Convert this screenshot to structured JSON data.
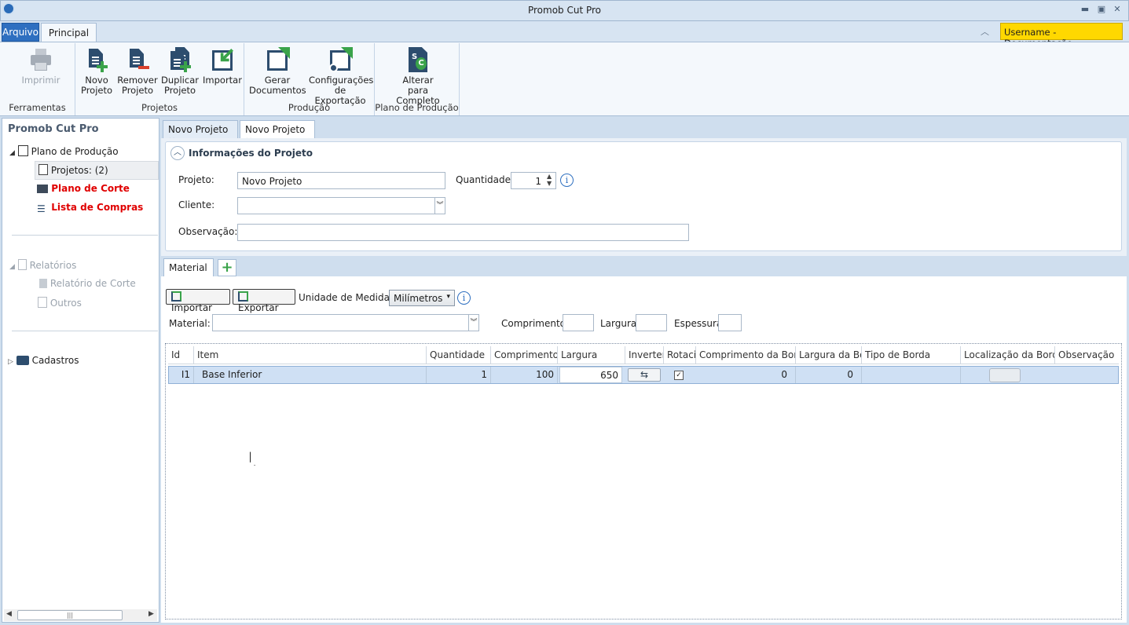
{
  "window": {
    "title": "Promob Cut Pro"
  },
  "ribbon": {
    "tabs": {
      "arquivo": "Arquivo",
      "principal": "Principal"
    },
    "user": "Username - Documentação",
    "groups": {
      "ferramentas": {
        "label": "Ferramentas",
        "imprimir": "Imprimir"
      },
      "projetos": {
        "label": "Projetos",
        "novo_1": "Novo",
        "novo_2": "Projeto",
        "remover_1": "Remover",
        "remover_2": "Projeto",
        "duplicar_1": "Duplicar",
        "duplicar_2": "Projeto",
        "importar": "Importar"
      },
      "producao": {
        "label": "Produção",
        "gerar_1": "Gerar",
        "gerar_2": "Documentos",
        "config_1": "Configurações",
        "config_2": "de Exportação"
      },
      "plano": {
        "label": "Plano de Produção",
        "alterar_1": "Alterar",
        "alterar_2": "para Completo"
      }
    }
  },
  "sidebar": {
    "title": "Promob Cut Pro",
    "plano_producao": "Plano de Produção",
    "projetos": "Projetos: (2)",
    "plano_corte": "Plano de Corte",
    "lista_compras": "Lista de Compras",
    "relatorios": "Relatórios",
    "relatorio_corte": "Relatório de Corte",
    "outros": "Outros",
    "cadastros": "Cadastros"
  },
  "doc_tabs": [
    "Novo Projeto",
    "Novo Projeto"
  ],
  "info": {
    "title": "Informações do Projeto",
    "projeto_label": "Projeto:",
    "projeto_value": "Novo Projeto",
    "quantidade_label": "Quantidade:",
    "quantidade_value": "1",
    "cliente_label": "Cliente:",
    "cliente_value": "",
    "observacao_label": "Observação:",
    "observacao_value": ""
  },
  "material_tab": "Material -",
  "toolbar": {
    "importar": "Importar",
    "exportar": "Exportar",
    "unidade_label": "Unidade de Medida :",
    "unidade_value": "Milímetros",
    "material_label": "Material:",
    "comprimento_label": "Comprimento:",
    "largura_label": "Largura:",
    "espessura_label": "Espessura:"
  },
  "table": {
    "columns": [
      "Id",
      "Item",
      "Quantidade",
      "Comprimento",
      "Largura",
      "Inverter",
      "Rotacionar",
      "Comprimento da Borda",
      "Largura da Borda",
      "Tipo de Borda",
      "Localização da Borda",
      "Observação"
    ],
    "rows": [
      {
        "id": "I1",
        "item": "Base Inferior",
        "quantidade": "1",
        "comprimento": "100",
        "largura": "650",
        "rotacionar": true,
        "comp_borda": "0",
        "larg_borda": "0",
        "tipo_borda": "",
        "observacao": ""
      }
    ]
  },
  "colors": {
    "accent": "#2e6fc0",
    "badge": "#ffd800",
    "red_text": "#e00000",
    "green_icon": "#3aa34a"
  }
}
